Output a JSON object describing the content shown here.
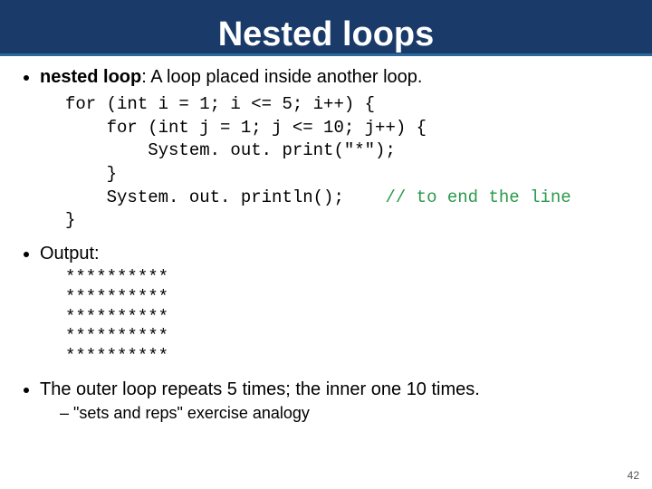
{
  "title": "Nested loops",
  "bullet1_term": "nested loop",
  "bullet1_rest": ": A loop placed inside another loop.",
  "code": {
    "l1": "for (int i = 1; i <= 5; i++) {",
    "l2": "    for (int j = 1; j <= 10; j++) {",
    "l3": "        System. out. print(\"*\");",
    "l4": "    }",
    "l5a": "    System. out. println();    ",
    "l5b": "// to end the line",
    "l6": "}"
  },
  "bullet2": "Output:",
  "output": "**********\n**********\n**********\n**********\n**********",
  "bullet3": "The outer loop repeats 5 times; the inner one 10 times.",
  "sub1": "\"sets and reps\" exercise analogy",
  "page": "42"
}
